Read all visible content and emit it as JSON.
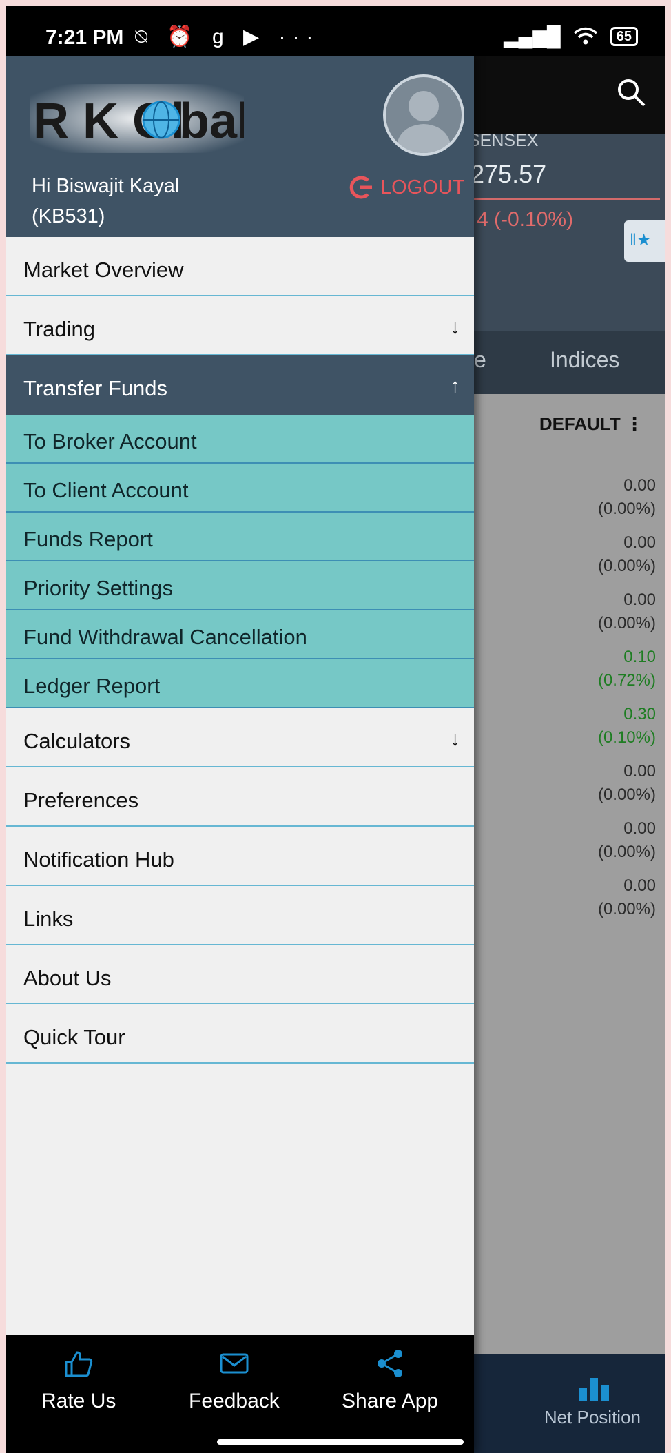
{
  "status_bar": {
    "time": "7:21 PM",
    "icons": "⍉ ⏰ g ▶ ···",
    "signal": "▂▄▆█",
    "wifi": "wifi",
    "battery": "65"
  },
  "background_app": {
    "index_label": "SENSEX",
    "index_value": "275.57",
    "index_change": "4 (-0.10%)",
    "tab_prev": "e",
    "tab_indices": "Indices",
    "sort_label": "DEFAULT ⋮",
    "values": [
      {
        "val": "0.00",
        "pct": "(0.00%)",
        "color": "neutral"
      },
      {
        "val": "0.00",
        "pct": "(0.00%)",
        "color": "neutral"
      },
      {
        "val": "0.00",
        "pct": "(0.00%)",
        "color": "neutral"
      },
      {
        "val": "0.10",
        "pct": "(0.72%)",
        "color": "green"
      },
      {
        "val": "0.30",
        "pct": "(0.10%)",
        "color": "green"
      },
      {
        "val": "0.00",
        "pct": "(0.00%)",
        "color": "neutral"
      },
      {
        "val": "0.00",
        "pct": "(0.00%)",
        "color": "neutral"
      },
      {
        "val": "0.00",
        "pct": "(0.00%)",
        "color": "neutral"
      }
    ],
    "bottom_tab": "Net Position"
  },
  "drawer": {
    "logo_text": "R K Global",
    "greeting_line1": "Hi Biswajit Kayal",
    "greeting_line2": "(KB531)",
    "logout_label": "LOGOUT",
    "menu": {
      "market_overview": "Market Overview",
      "trading": "Trading",
      "transfer_funds": "Transfer Funds",
      "sub_items": [
        "To Broker Account",
        "To Client Account",
        "Funds Report",
        "Priority Settings",
        "Fund Withdrawal Cancellation",
        "Ledger Report"
      ],
      "calculators": "Calculators",
      "preferences": "Preferences",
      "notification_hub": "Notification Hub",
      "links": "Links",
      "about_us": "About Us",
      "quick_tour": "Quick Tour"
    },
    "arrows": {
      "down": "↓",
      "up": "↑"
    },
    "footer": {
      "rate_us": "Rate Us",
      "feedback": "Feedback",
      "share_app": "Share App"
    }
  },
  "colors": {
    "accent": "#1b8fd0",
    "header": "#3f5365",
    "submenu": "#76c8c6",
    "logout": "#e8555b",
    "green": "#1e7d22"
  }
}
